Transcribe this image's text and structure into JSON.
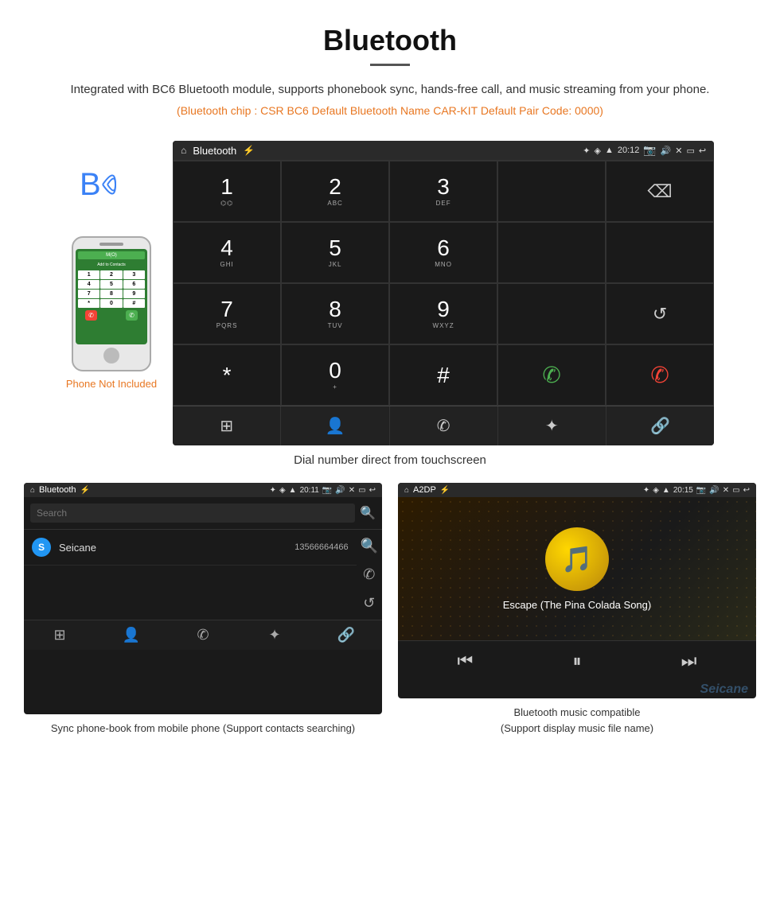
{
  "page": {
    "title": "Bluetooth",
    "description": "Integrated with BC6 Bluetooth module, supports phonebook sync, hands-free call, and music streaming from your phone.",
    "specs": "(Bluetooth chip : CSR BC6    Default Bluetooth Name CAR-KIT    Default Pair Code: 0000)"
  },
  "dial_screen": {
    "status_bar": {
      "left": "⌂",
      "title": "Bluetooth",
      "usb_icon": "⚡",
      "bt_icon": "✦",
      "location_icon": "◈",
      "signal_icon": "▲",
      "time": "20:12",
      "camera_icon": "📷",
      "volume_icon": "🔊",
      "close_icon": "✕",
      "screen_icon": "▭",
      "back_icon": "↩"
    },
    "keys": [
      {
        "num": "1",
        "sub": "⌬⌬"
      },
      {
        "num": "2",
        "sub": "ABC"
      },
      {
        "num": "3",
        "sub": "DEF"
      },
      {
        "num": "",
        "sub": ""
      },
      {
        "num": "⌫",
        "sub": ""
      },
      {
        "num": "4",
        "sub": "GHI"
      },
      {
        "num": "5",
        "sub": "JKL"
      },
      {
        "num": "6",
        "sub": "MNO"
      },
      {
        "num": "",
        "sub": ""
      },
      {
        "num": "",
        "sub": ""
      },
      {
        "num": "7",
        "sub": "PQRS"
      },
      {
        "num": "8",
        "sub": "TUV"
      },
      {
        "num": "9",
        "sub": "WXYZ"
      },
      {
        "num": "",
        "sub": ""
      },
      {
        "num": "↺",
        "sub": ""
      },
      {
        "num": "*",
        "sub": ""
      },
      {
        "num": "0",
        "sub": "+"
      },
      {
        "num": "#",
        "sub": ""
      },
      {
        "num": "✆",
        "sub": "green"
      },
      {
        "num": "✆",
        "sub": "red"
      }
    ],
    "nav_icons": [
      "⊞",
      "👤",
      "✆",
      "✦",
      "🔗"
    ]
  },
  "main_caption": "Dial number direct from touchscreen",
  "phone_not_included": "Phone Not Included",
  "phonebook_screen": {
    "title": "Bluetooth",
    "time": "20:11",
    "search_placeholder": "Search",
    "contact": {
      "letter": "S",
      "name": "Seicane",
      "phone": "13566664466"
    },
    "nav_icons": [
      "⊞",
      "👤",
      "✆",
      "✦",
      "🔗"
    ],
    "caption": "Sync phone-book from mobile phone\n(Support contacts searching)"
  },
  "music_screen": {
    "title": "A2DP",
    "time": "20:15",
    "song_title": "Escape (The Pina Colada Song)",
    "controls": [
      "⏮",
      "⏭|",
      "⏭"
    ],
    "caption": "Bluetooth music compatible\n(Support display music file name)"
  },
  "watermark": "Seicane"
}
